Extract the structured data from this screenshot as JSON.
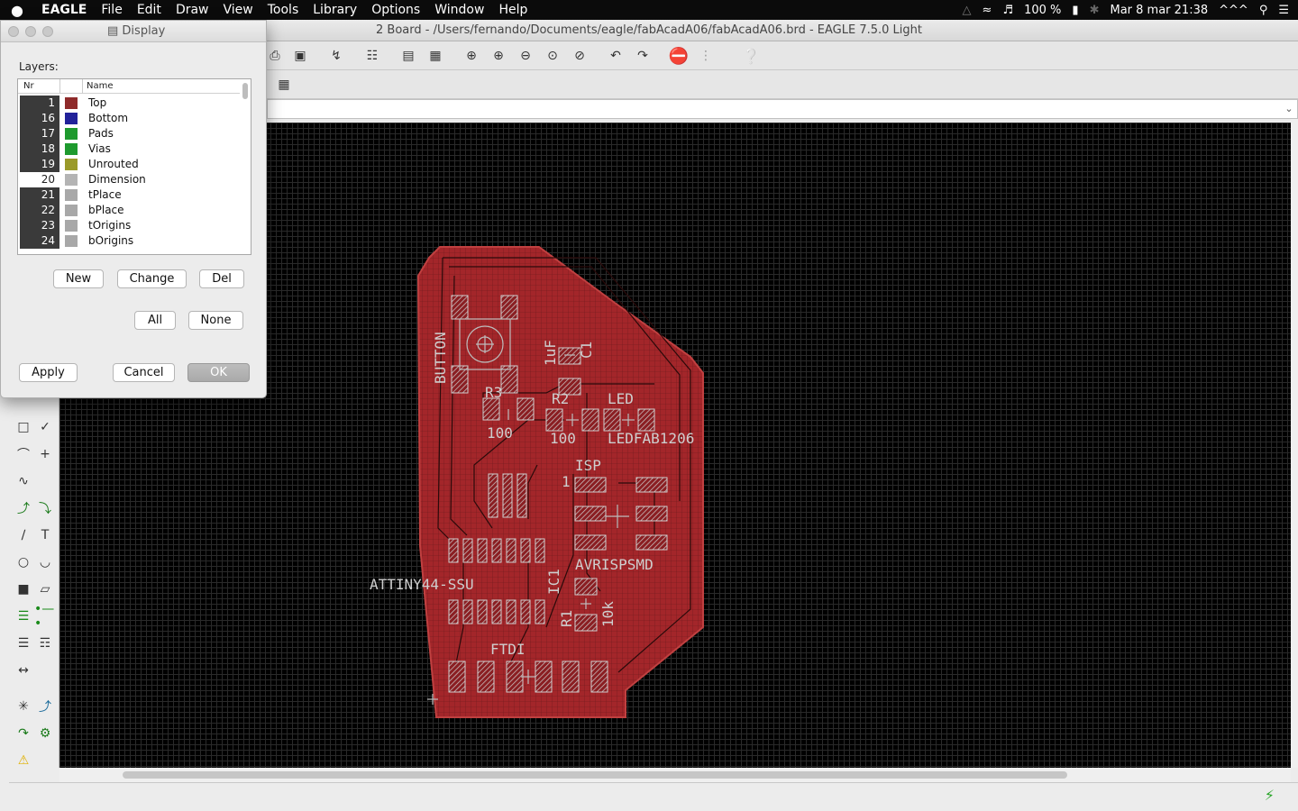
{
  "menubar": {
    "apple": "",
    "app_name": "EAGLE",
    "items": [
      "File",
      "Edit",
      "Draw",
      "View",
      "Tools",
      "Library",
      "Options",
      "Window",
      "Help"
    ],
    "battery": "100 %",
    "date_time": "Mar 8 mar  21:38",
    "extra": "^^^"
  },
  "window": {
    "title": "2 Board - /Users/fernando/Documents/eagle/fabAcadA06/fabAcadA06.brd - EAGLE 7.5.0 Light"
  },
  "dialog": {
    "title": "Display",
    "layers_label": "Layers:",
    "columns": {
      "nr": "Nr",
      "name": "Name"
    },
    "layers": [
      {
        "nr": "1",
        "name": "Top",
        "color": "#8e2a2a",
        "active": true
      },
      {
        "nr": "16",
        "name": "Bottom",
        "color": "#22229a",
        "active": true
      },
      {
        "nr": "17",
        "name": "Pads",
        "color": "#1e9a2e",
        "active": true
      },
      {
        "nr": "18",
        "name": "Vias",
        "color": "#1e9a2e",
        "active": true
      },
      {
        "nr": "19",
        "name": "Unrouted",
        "color": "#9a9a2a",
        "active": true
      },
      {
        "nr": "20",
        "name": "Dimension",
        "color": "#b4b4b4",
        "active": false
      },
      {
        "nr": "21",
        "name": "tPlace",
        "color": "#a8a8a8",
        "active": true
      },
      {
        "nr": "22",
        "name": "bPlace",
        "color": "#a8a8a8",
        "active": true
      },
      {
        "nr": "23",
        "name": "tOrigins",
        "color": "#a8a8a8",
        "active": true
      },
      {
        "nr": "24",
        "name": "bOrigins",
        "color": "#a8a8a8",
        "active": true
      }
    ],
    "buttons": {
      "new": "New",
      "change": "Change",
      "del": "Del",
      "all": "All",
      "none": "None",
      "apply": "Apply",
      "cancel": "Cancel",
      "ok": "OK"
    }
  },
  "pcb": {
    "labels": {
      "button": "BUTTON",
      "r3": "R3",
      "r3_val": "100",
      "c1": "C1",
      "c1_val": "1uF",
      "r2": "R2",
      "r2_val": "100",
      "led": "LED",
      "led_val": "LEDFAB1206",
      "isp": "ISP",
      "pin1": "1",
      "avrispsmd": "AVRISPSMD",
      "attiny": "ATTINY44-SSU",
      "ic1": "IC1",
      "r1": "R1",
      "r1_val": "10k",
      "ftdi": "FTDI"
    }
  }
}
